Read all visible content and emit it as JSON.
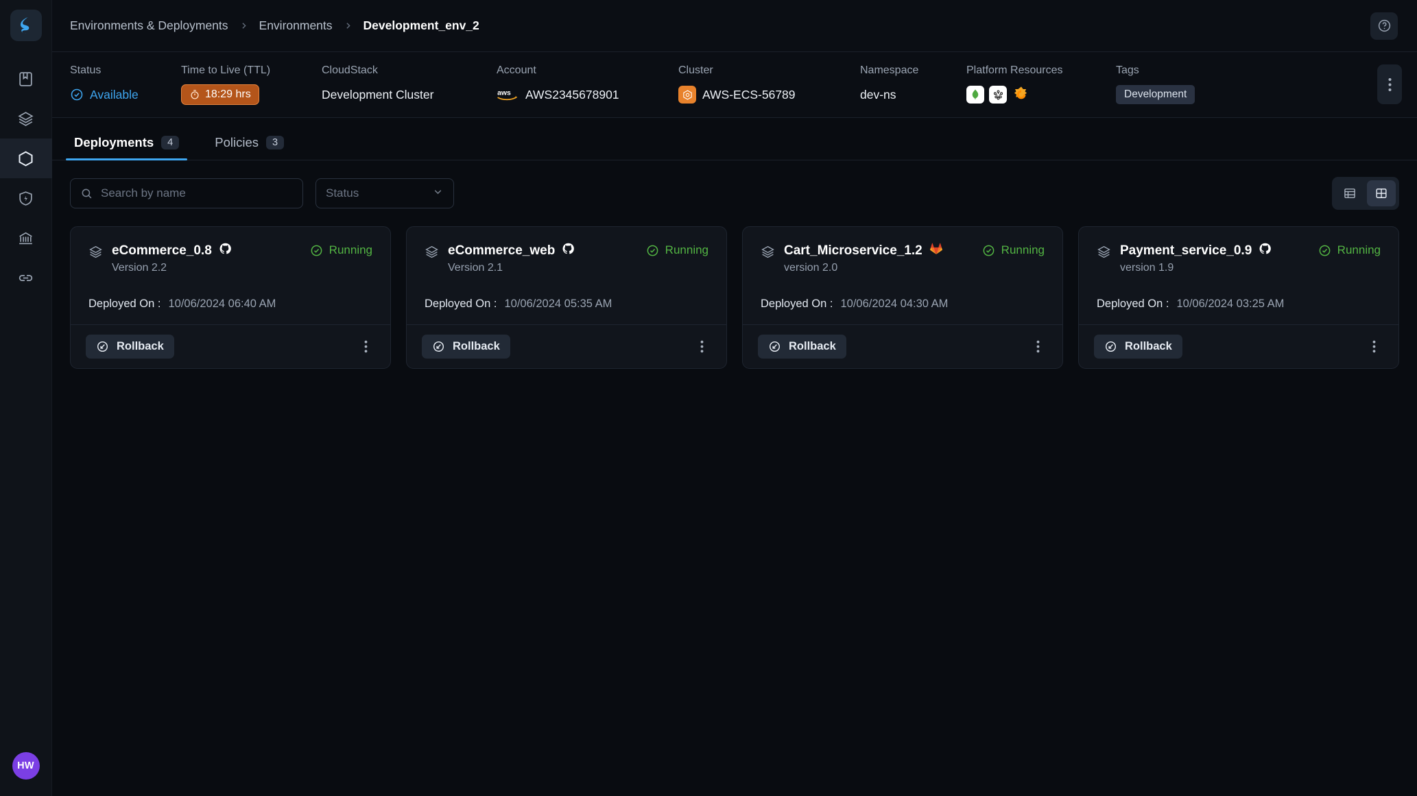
{
  "app": {
    "logo_icon": "spectro-cloud-logo",
    "avatar_initials": "HW"
  },
  "sidebar": {
    "items": [
      {
        "name": "catalog",
        "icon": "book-icon",
        "active": false
      },
      {
        "name": "clusters",
        "icon": "layers-icon",
        "active": false
      },
      {
        "name": "environments",
        "icon": "hexagon-icon",
        "active": true
      },
      {
        "name": "security",
        "icon": "shield-bolt-icon",
        "active": false
      },
      {
        "name": "governance",
        "icon": "bank-icon",
        "active": false
      },
      {
        "name": "integrations",
        "icon": "link-icon",
        "active": false
      }
    ]
  },
  "breadcrumb": {
    "items": [
      "Environments & Deployments",
      "Environments",
      "Development_env_2"
    ],
    "separator_icon": "chevron-right-icon",
    "help_icon": "help-circle-icon"
  },
  "meta": {
    "status": {
      "label": "Status",
      "value": "Available",
      "icon": "check-circle-icon",
      "color": "#3ea6f0"
    },
    "ttl": {
      "label": "Time to Live (TTL)",
      "value": "18:29 hrs",
      "icon": "timer-icon",
      "color": "#e8853e"
    },
    "cloudstack": {
      "label": "CloudStack",
      "value": "Development Cluster"
    },
    "account": {
      "label": "Account",
      "value": "AWS2345678901",
      "icon": "aws-logo"
    },
    "cluster": {
      "label": "Cluster",
      "value": "AWS-ECS-56789",
      "icon": "kubernetes-badge-icon",
      "color": "#e8822c"
    },
    "namespace": {
      "label": "Namespace",
      "value": "dev-ns"
    },
    "platform_resources": {
      "label": "Platform Resources",
      "icons": [
        "mongodb-icon",
        "kubernetes-icon",
        "grafana-icon"
      ]
    },
    "tags": {
      "label": "Tags",
      "values": [
        "Development"
      ]
    },
    "kebab_icon": "more-vertical-icon"
  },
  "tabs": [
    {
      "label": "Deployments",
      "count": "4",
      "active": true
    },
    {
      "label": "Policies",
      "count": "3",
      "active": false
    }
  ],
  "toolbar": {
    "search_placeholder": "Search by name",
    "search_value": "",
    "search_icon": "search-icon",
    "status_filter_label": "Status",
    "status_filter_icon": "chevron-down-icon",
    "view_list_icon": "list-view-icon",
    "view_grid_icon": "grid-view-icon",
    "active_view": "grid"
  },
  "deployments": [
    {
      "name": "eCommerce_0.8",
      "repo_icon": "github-icon",
      "version": "Version 2.2",
      "status": "Running",
      "status_icon": "check-circle-icon",
      "deployed_label": "Deployed On :",
      "deployed_on": "10/06/2024 06:40 AM",
      "rollback_label": "Rollback",
      "rollback_icon": "rollback-icon",
      "kebab_icon": "more-vertical-icon",
      "stack_icon": "layers-icon"
    },
    {
      "name": "eCommerce_web",
      "repo_icon": "github-icon",
      "version": "Version 2.1",
      "status": "Running",
      "status_icon": "check-circle-icon",
      "deployed_label": "Deployed On :",
      "deployed_on": "10/06/2024 05:35 AM",
      "rollback_label": "Rollback",
      "rollback_icon": "rollback-icon",
      "kebab_icon": "more-vertical-icon",
      "stack_icon": "layers-icon"
    },
    {
      "name": "Cart_Microservice_1.2",
      "repo_icon": "gitlab-icon",
      "version": "version 2.0",
      "status": "Running",
      "status_icon": "check-circle-icon",
      "deployed_label": "Deployed On :",
      "deployed_on": "10/06/2024 04:30 AM",
      "rollback_label": "Rollback",
      "rollback_icon": "rollback-icon",
      "kebab_icon": "more-vertical-icon",
      "stack_icon": "layers-icon"
    },
    {
      "name": "Payment_service_0.9",
      "repo_icon": "github-icon",
      "version": "version 1.9",
      "status": "Running",
      "status_icon": "check-circle-icon",
      "deployed_label": "Deployed On :",
      "deployed_on": "10/06/2024 03:25 AM",
      "rollback_label": "Rollback",
      "rollback_icon": "rollback-icon",
      "kebab_icon": "more-vertical-icon",
      "stack_icon": "layers-icon"
    }
  ],
  "colors": {
    "accent": "#3ea6f0",
    "running": "#53b543",
    "ttl": "#e8853e",
    "avatar": "#7b3fe4",
    "page_bg": "#090c11",
    "card_bg": "#11151c"
  }
}
